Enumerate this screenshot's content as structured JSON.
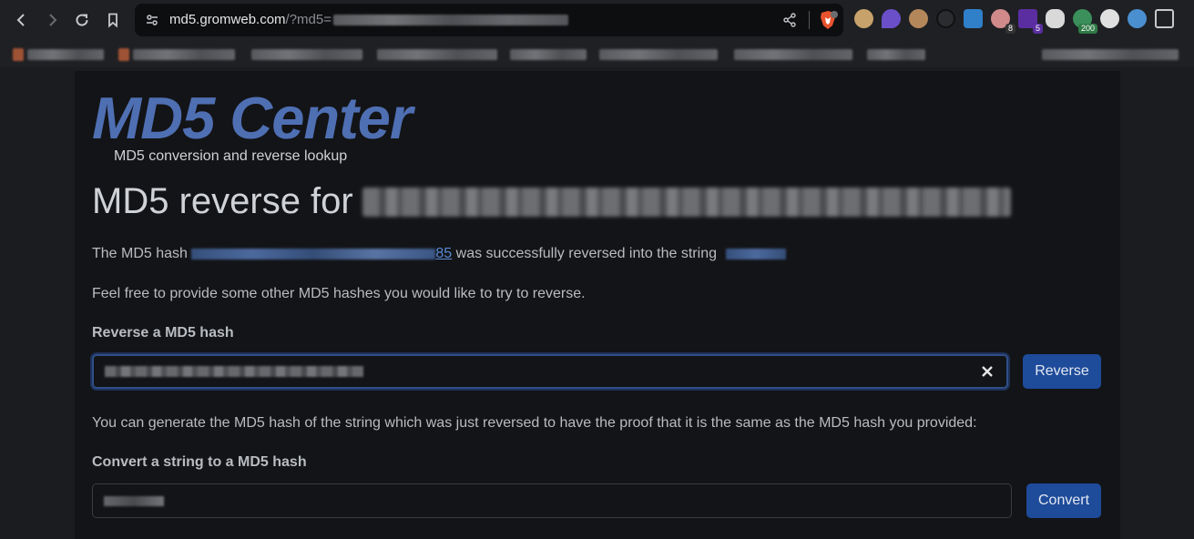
{
  "browser": {
    "url_host": "md5.gromweb.com",
    "url_query": "/?md5=",
    "extension_badges": [
      "8",
      "5",
      "200"
    ]
  },
  "page": {
    "logo": "MD5 Center",
    "tagline": "MD5 conversion and reverse lookup",
    "heading": "MD5 reverse for",
    "result_prefix": "The MD5 hash",
    "result_hash_suffix": "85",
    "result_middle": "was successfully reversed into the string",
    "invite_text": "Feel free to provide some other MD5 hashes you would like to try to reverse.",
    "reverse_label": "Reverse a MD5 hash",
    "reverse_button": "Reverse",
    "proof_text": "You can generate the MD5 hash of the string which was just reversed to have the proof that it is the same as the MD5 hash you provided:",
    "convert_label": "Convert a string to a MD5 hash",
    "convert_button": "Convert"
  },
  "colors": {
    "logo": "#4f6fb3",
    "link": "#5b8bd6",
    "button": "#1e4b9a"
  }
}
